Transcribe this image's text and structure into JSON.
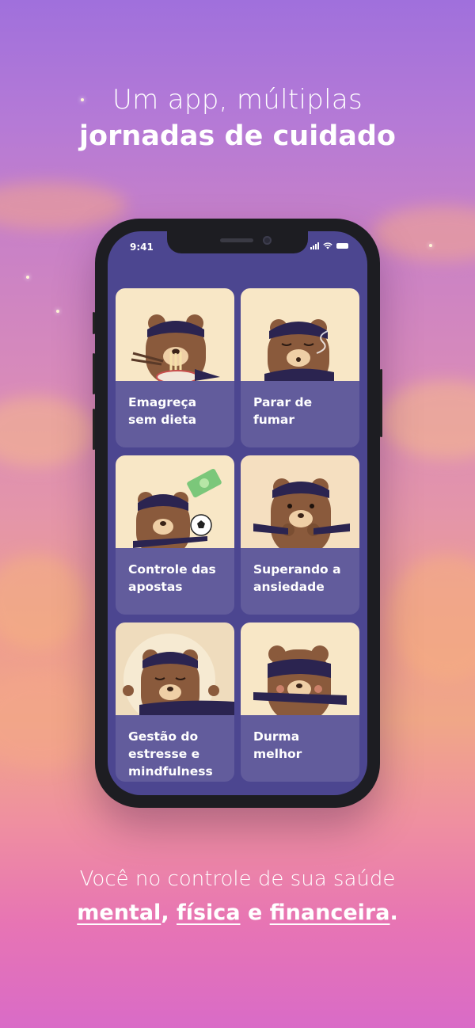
{
  "headline": {
    "line1": "Um app, múltiplas",
    "line2": "jornadas de cuidado"
  },
  "phone": {
    "time": "9:41"
  },
  "cards": [
    {
      "label": "Emagreça sem dieta",
      "icon": "bear-eating-noodles-icon"
    },
    {
      "label": "Parar de fumar",
      "icon": "bear-smoking-icon"
    },
    {
      "label": "Controle das apostas",
      "icon": "bear-gambling-icon"
    },
    {
      "label": "Superando a ansiedade",
      "icon": "bear-anxious-icon"
    },
    {
      "label": "Gestão do estresse e mindfulness",
      "icon": "bear-meditating-icon"
    },
    {
      "label": "Durma melhor",
      "icon": "bear-sleeping-icon"
    }
  ],
  "footer": {
    "line1": "Você no controle de sua saúde",
    "word1": "mental",
    "sep1": ", ",
    "word2": "física",
    "sep2": " e ",
    "word3": "financeira",
    "end": "."
  },
  "colors": {
    "screen": "#4c4690",
    "card": "#625c9c",
    "bear": "#8a5a3c",
    "mask": "#2b2450"
  }
}
